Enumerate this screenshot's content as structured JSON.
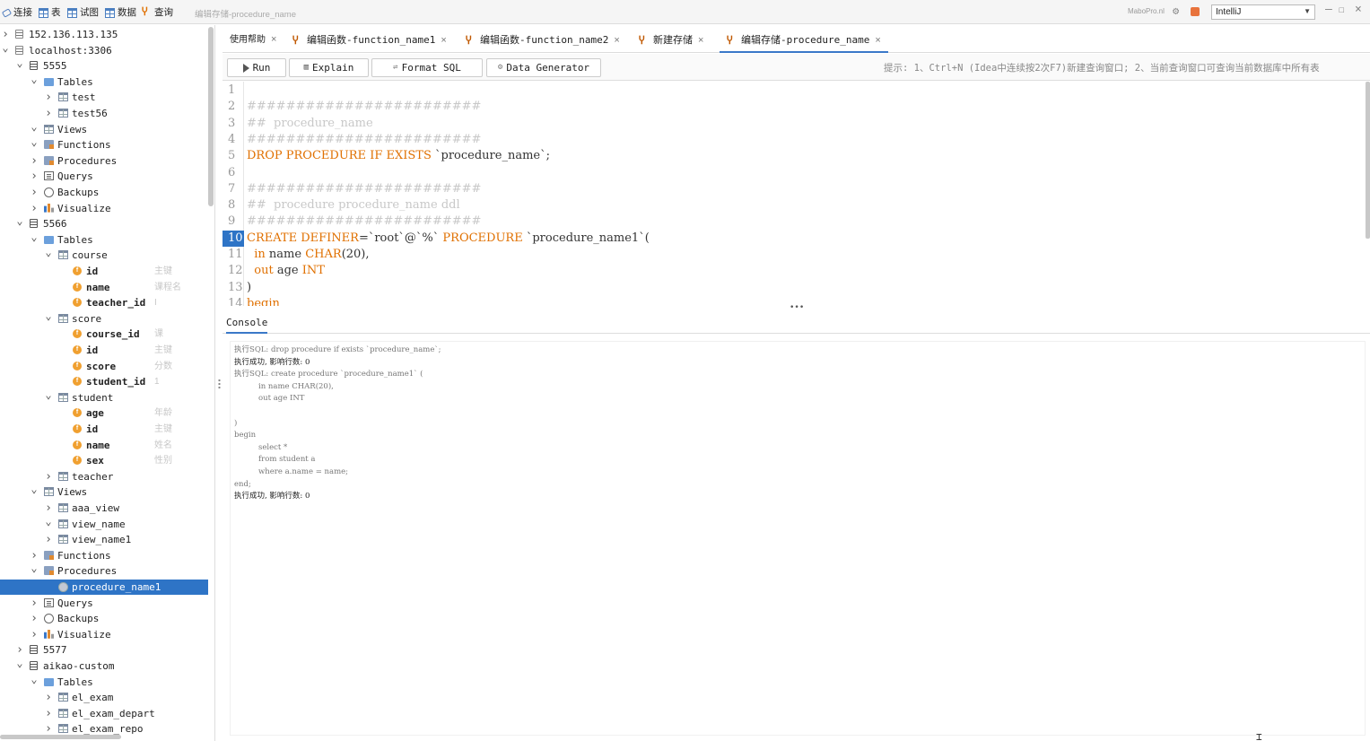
{
  "toolbar": {
    "connect": "连接",
    "table": "表",
    "view": "试图",
    "data": "数据",
    "query": "查询",
    "title": "编辑存储-procedure_name",
    "plugin": "MaboPro.nl",
    "theme": "IntelliJ"
  },
  "tabs": [
    {
      "label": "使用帮助"
    },
    {
      "label": "编辑函数-function_name1"
    },
    {
      "label": "编辑函数-function_name2"
    },
    {
      "label": "新建存储"
    },
    {
      "label": "编辑存储-procedure_name"
    }
  ],
  "editor_toolbar": {
    "run": "Run",
    "explain": "Explain",
    "format": "Format SQL",
    "generator": "Data Generator",
    "hint": "提示: 1、Ctrl+N (Idea中连续按2次F7)新建查询窗口; 2、当前查询窗口可查询当前数据库中所有表"
  },
  "tree": [
    {
      "label": "152.136.113.135"
    },
    {
      "label": "localhost:3306"
    },
    {
      "label": "5555"
    },
    {
      "label": "Tables"
    },
    {
      "label": "test"
    },
    {
      "label": "test56"
    },
    {
      "label": "Views"
    },
    {
      "label": "Functions"
    },
    {
      "label": "Procedures"
    },
    {
      "label": "Querys"
    },
    {
      "label": "Backups"
    },
    {
      "label": "Visualize"
    },
    {
      "label": "5566"
    },
    {
      "label": "Tables"
    },
    {
      "label": "course"
    },
    {
      "label": "id",
      "comment": "主键"
    },
    {
      "label": "name",
      "comment": "课程名"
    },
    {
      "label": "teacher_id",
      "comment": "I"
    },
    {
      "label": "score"
    },
    {
      "label": "course_id",
      "comment": "课"
    },
    {
      "label": "id",
      "comment": "主键"
    },
    {
      "label": "score",
      "comment": "分数"
    },
    {
      "label": "student_id",
      "comment": "1"
    },
    {
      "label": "student"
    },
    {
      "label": "age",
      "comment": "年龄"
    },
    {
      "label": "id",
      "comment": "主键"
    },
    {
      "label": "name",
      "comment": "姓名"
    },
    {
      "label": "sex",
      "comment": "性别"
    },
    {
      "label": "teacher"
    },
    {
      "label": "Views"
    },
    {
      "label": "aaa_view"
    },
    {
      "label": "view_name"
    },
    {
      "label": "view_name1"
    },
    {
      "label": "Functions"
    },
    {
      "label": "Procedures"
    },
    {
      "label": "procedure_name1"
    },
    {
      "label": "Querys"
    },
    {
      "label": "Backups"
    },
    {
      "label": "Visualize"
    },
    {
      "label": "5577"
    },
    {
      "label": "aikao-custom"
    },
    {
      "label": "Tables"
    },
    {
      "label": "el_exam"
    },
    {
      "label": "el_exam_depart"
    },
    {
      "label": "el_exam_repo"
    }
  ],
  "editor": {
    "line_numbers": [
      "1",
      "2",
      "3",
      "4",
      "5",
      "6",
      "7",
      "8",
      "9",
      "10",
      "11",
      "12",
      "13",
      "14"
    ],
    "lines": [
      "",
      "########################",
      "##  procedure_name",
      "########################",
      "DROP PROCEDURE IF EXISTS `procedure_name`;",
      "",
      "########################",
      "##  procedure procedure_name ddl",
      "########################",
      "CREATE DEFINER=`root`@`%` PROCEDURE `procedure_name1`(",
      "  in name CHAR(20),",
      "  out age INT",
      ")",
      "begin"
    ]
  },
  "console": {
    "tab": "Console",
    "lines": [
      "执行SQL: drop procedure if exists `procedure_name`;",
      "执行成功, 影响行数: 0",
      "执行SQL: create procedure `procedure_name1` (",
      "          in name CHAR(20),",
      "          out age INT",
      "",
      ")",
      "begin",
      "          select *",
      "          from student a",
      "          where a.name = name;",
      "end;",
      "执行成功, 影响行数: 0"
    ]
  },
  "colors": {
    "accent": "#2e74c6",
    "keyword": "#e07000",
    "comment": "#c8c8c8"
  }
}
